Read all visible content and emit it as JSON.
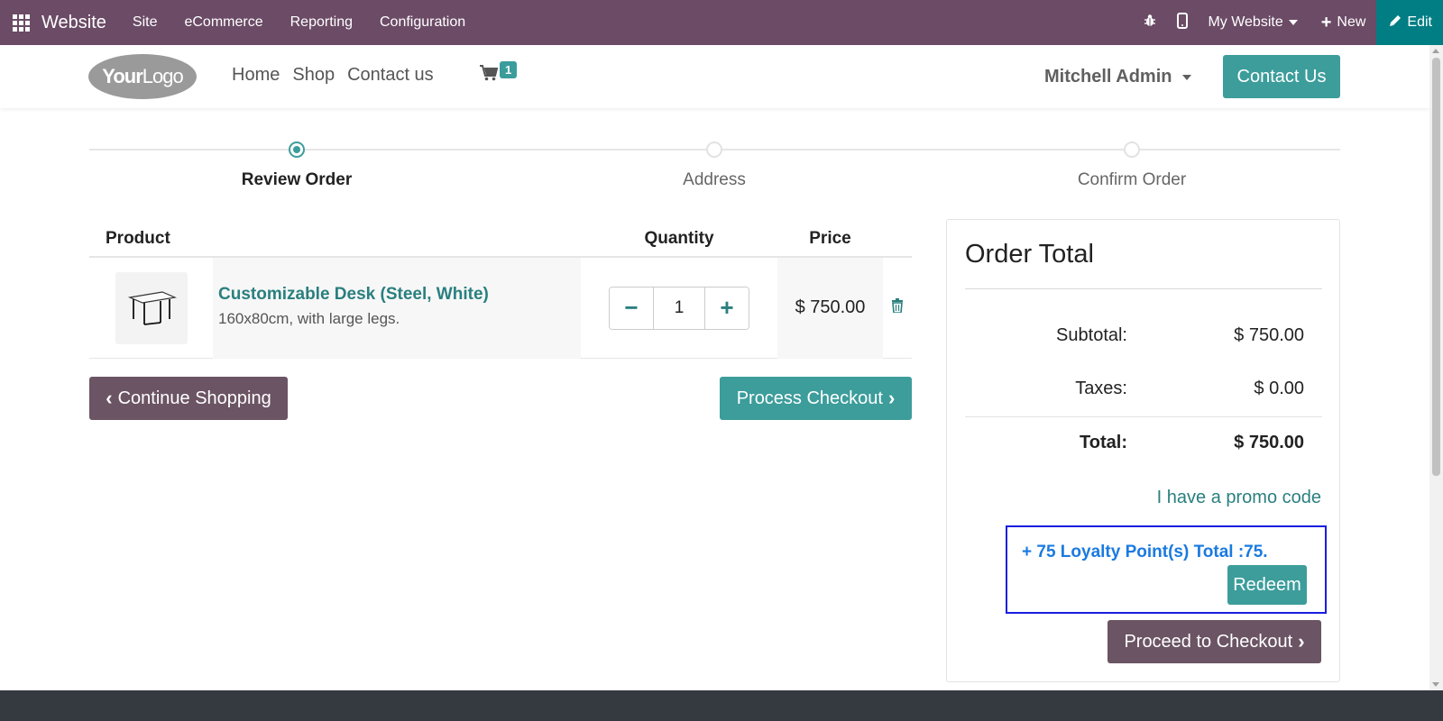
{
  "admin_bar": {
    "brand": "Website",
    "menu": [
      "Site",
      "eCommerce",
      "Reporting",
      "Configuration"
    ],
    "my_website": "My Website",
    "new_label": "New",
    "edit_label": "Edit"
  },
  "header": {
    "logo_bold": "Your",
    "logo_thin": "Logo",
    "nav": [
      "Home",
      "Shop",
      "Contact us"
    ],
    "cart_count": "1",
    "user": "Mitchell Admin",
    "contact_button": "Contact Us"
  },
  "progress": {
    "steps": [
      {
        "label": "Review Order",
        "active": true
      },
      {
        "label": "Address",
        "active": false
      },
      {
        "label": "Confirm Order",
        "active": false
      }
    ]
  },
  "cart": {
    "columns": {
      "product": "Product",
      "quantity": "Quantity",
      "price": "Price"
    },
    "items": [
      {
        "name": "Customizable Desk (Steel, White)",
        "description": "160x80cm, with large legs.",
        "quantity": "1",
        "price": "$ 750.00"
      }
    ],
    "continue_label": "Continue Shopping",
    "checkout_label": "Process Checkout"
  },
  "order_total": {
    "title": "Order Total",
    "subtotal_label": "Subtotal:",
    "subtotal_value": "$ 750.00",
    "taxes_label": "Taxes:",
    "taxes_value": "$ 0.00",
    "total_label": "Total:",
    "total_value": "$ 750.00",
    "promo_label": "I have a promo code",
    "loyalty_text": "+ 75 Loyalty Point(s) Total :75.",
    "redeem_label": "Redeem",
    "proceed_label": "Proceed to Checkout"
  },
  "colors": {
    "admin_bar": "#6b4b66",
    "primary": "#3c9d9b",
    "secondary": "#6b5464",
    "loyalty_border": "#1a1ee0"
  }
}
